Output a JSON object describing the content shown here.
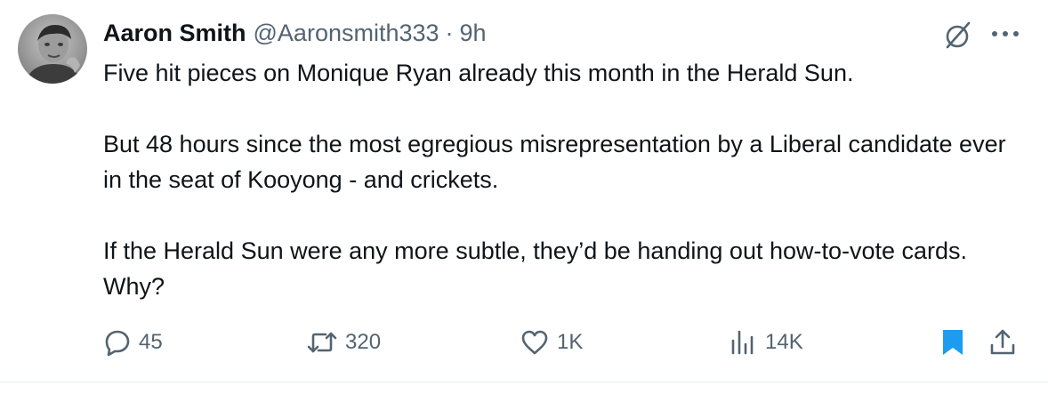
{
  "author": {
    "display_name": "Aaron Smith",
    "handle": "@Aaronsmith333",
    "separator": "·",
    "time": "9h"
  },
  "tweet": {
    "paragraphs": [
      "Five hit pieces on Monique Ryan already this month in the Herald Sun.",
      "But 48 hours since the most egregious misrepresentation by a Liberal candidate ever in the seat of Kooyong - and crickets.",
      "If the Herald Sun were any more subtle, they’d be handing out how-to-vote cards. Why?"
    ]
  },
  "actions": {
    "reply_count": "45",
    "retweet_count": "320",
    "like_count": "1K",
    "views_count": "14K"
  },
  "icons": {
    "avatar": "avatar",
    "grok": "grok-icon",
    "more": "more-icon",
    "reply": "reply-icon",
    "retweet": "retweet-icon",
    "like": "heart-icon",
    "views": "views-icon",
    "bookmark": "bookmark-icon",
    "share": "share-icon"
  },
  "colors": {
    "text_primary": "#0f1419",
    "text_secondary": "#536471",
    "bookmark_active": "#1d9bf0",
    "divider": "#e6ecf0"
  }
}
